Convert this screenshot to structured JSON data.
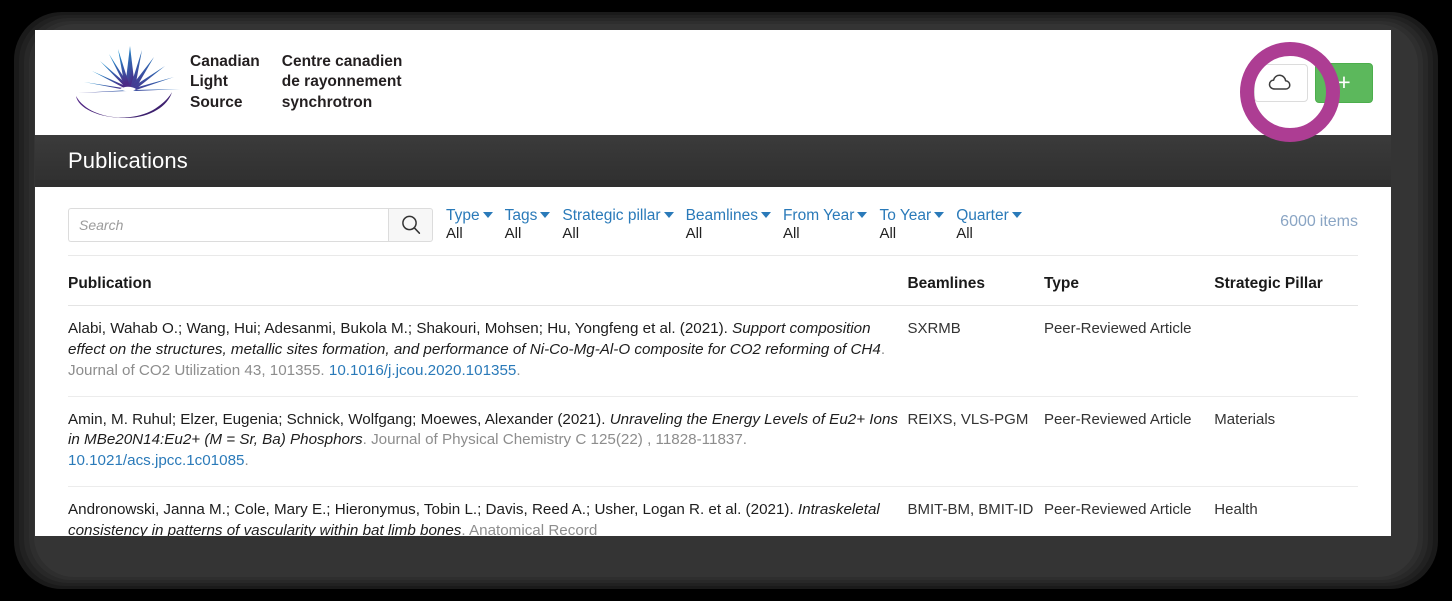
{
  "brand": {
    "logo_icon": "cls-starburst-logo",
    "wordmark_en": [
      "Canadian",
      "Light",
      "Source"
    ],
    "wordmark_fr": [
      "Centre canadien",
      "de rayonnement",
      "synchrotron"
    ]
  },
  "header_actions": {
    "export_icon": "cloud-icon",
    "add_label": "+",
    "highlight_color": "#ad3d93",
    "add_button_color": "#5cb85c"
  },
  "page": {
    "title": "Publications"
  },
  "search": {
    "placeholder": "Search",
    "value": "",
    "icon": "search-icon"
  },
  "filters": [
    {
      "label": "Type",
      "value": "All"
    },
    {
      "label": "Tags",
      "value": "All"
    },
    {
      "label": "Strategic pillar",
      "value": "All"
    },
    {
      "label": "Beamlines",
      "value": "All"
    },
    {
      "label": "From Year",
      "value": "All"
    },
    {
      "label": "To Year",
      "value": "All"
    },
    {
      "label": "Quarter",
      "value": "All"
    }
  ],
  "count": {
    "number": "6000",
    "unit": "items"
  },
  "table": {
    "headers": {
      "publication": "Publication",
      "beamlines": "Beamlines",
      "type": "Type",
      "strategic_pillar": "Strategic Pillar"
    },
    "rows": [
      {
        "authors": "Alabi, Wahab O.; Wang, Hui; Adesanmi, Bukola M.; Shakouri, Mohsen; Hu, Yongfeng et al. (2021). ",
        "title": "Support composition effect on the structures, metallic sites formation, and performance of Ni-Co-Mg-Al-O composite for CO2 reforming of CH4",
        "journal": ". Journal of CO2 Utilization 43, 101355. ",
        "doi": "10.1016/j.jcou.2020.101355",
        "doi_suffix": ".",
        "beamlines": "SXRMB",
        "type": "Peer-Reviewed Article",
        "pillar": ""
      },
      {
        "authors": "Amin, M. Ruhul; Elzer, Eugenia; Schnick, Wolfgang; Moewes, Alexander (2021). ",
        "title": "Unraveling the Energy Levels of Eu2+ Ions in MBe20N14:Eu2+ (M = Sr, Ba) Phosphors",
        "journal": ". Journal of Physical Chemistry C 125(22) , 11828-11837. ",
        "doi": "10.1021/acs.jpcc.1c01085",
        "doi_suffix": ".",
        "beamlines": "REIXS, VLS-PGM",
        "type": "Peer-Reviewed Article",
        "pillar": "Materials"
      },
      {
        "authors": "Andronowski, Janna M.; Cole, Mary E.; Hieronymus, Tobin L.; Davis, Reed A.; Usher, Logan R. et al. (2021). ",
        "title": "Intraskeletal consistency in patterns of vascularity within bat limb bones",
        "journal": ". Anatomical Record",
        "doi": "",
        "doi_suffix": "",
        "beamlines": "BMIT-BM, BMIT-ID",
        "type": "Peer-Reviewed Article",
        "pillar": "Health"
      }
    ]
  }
}
